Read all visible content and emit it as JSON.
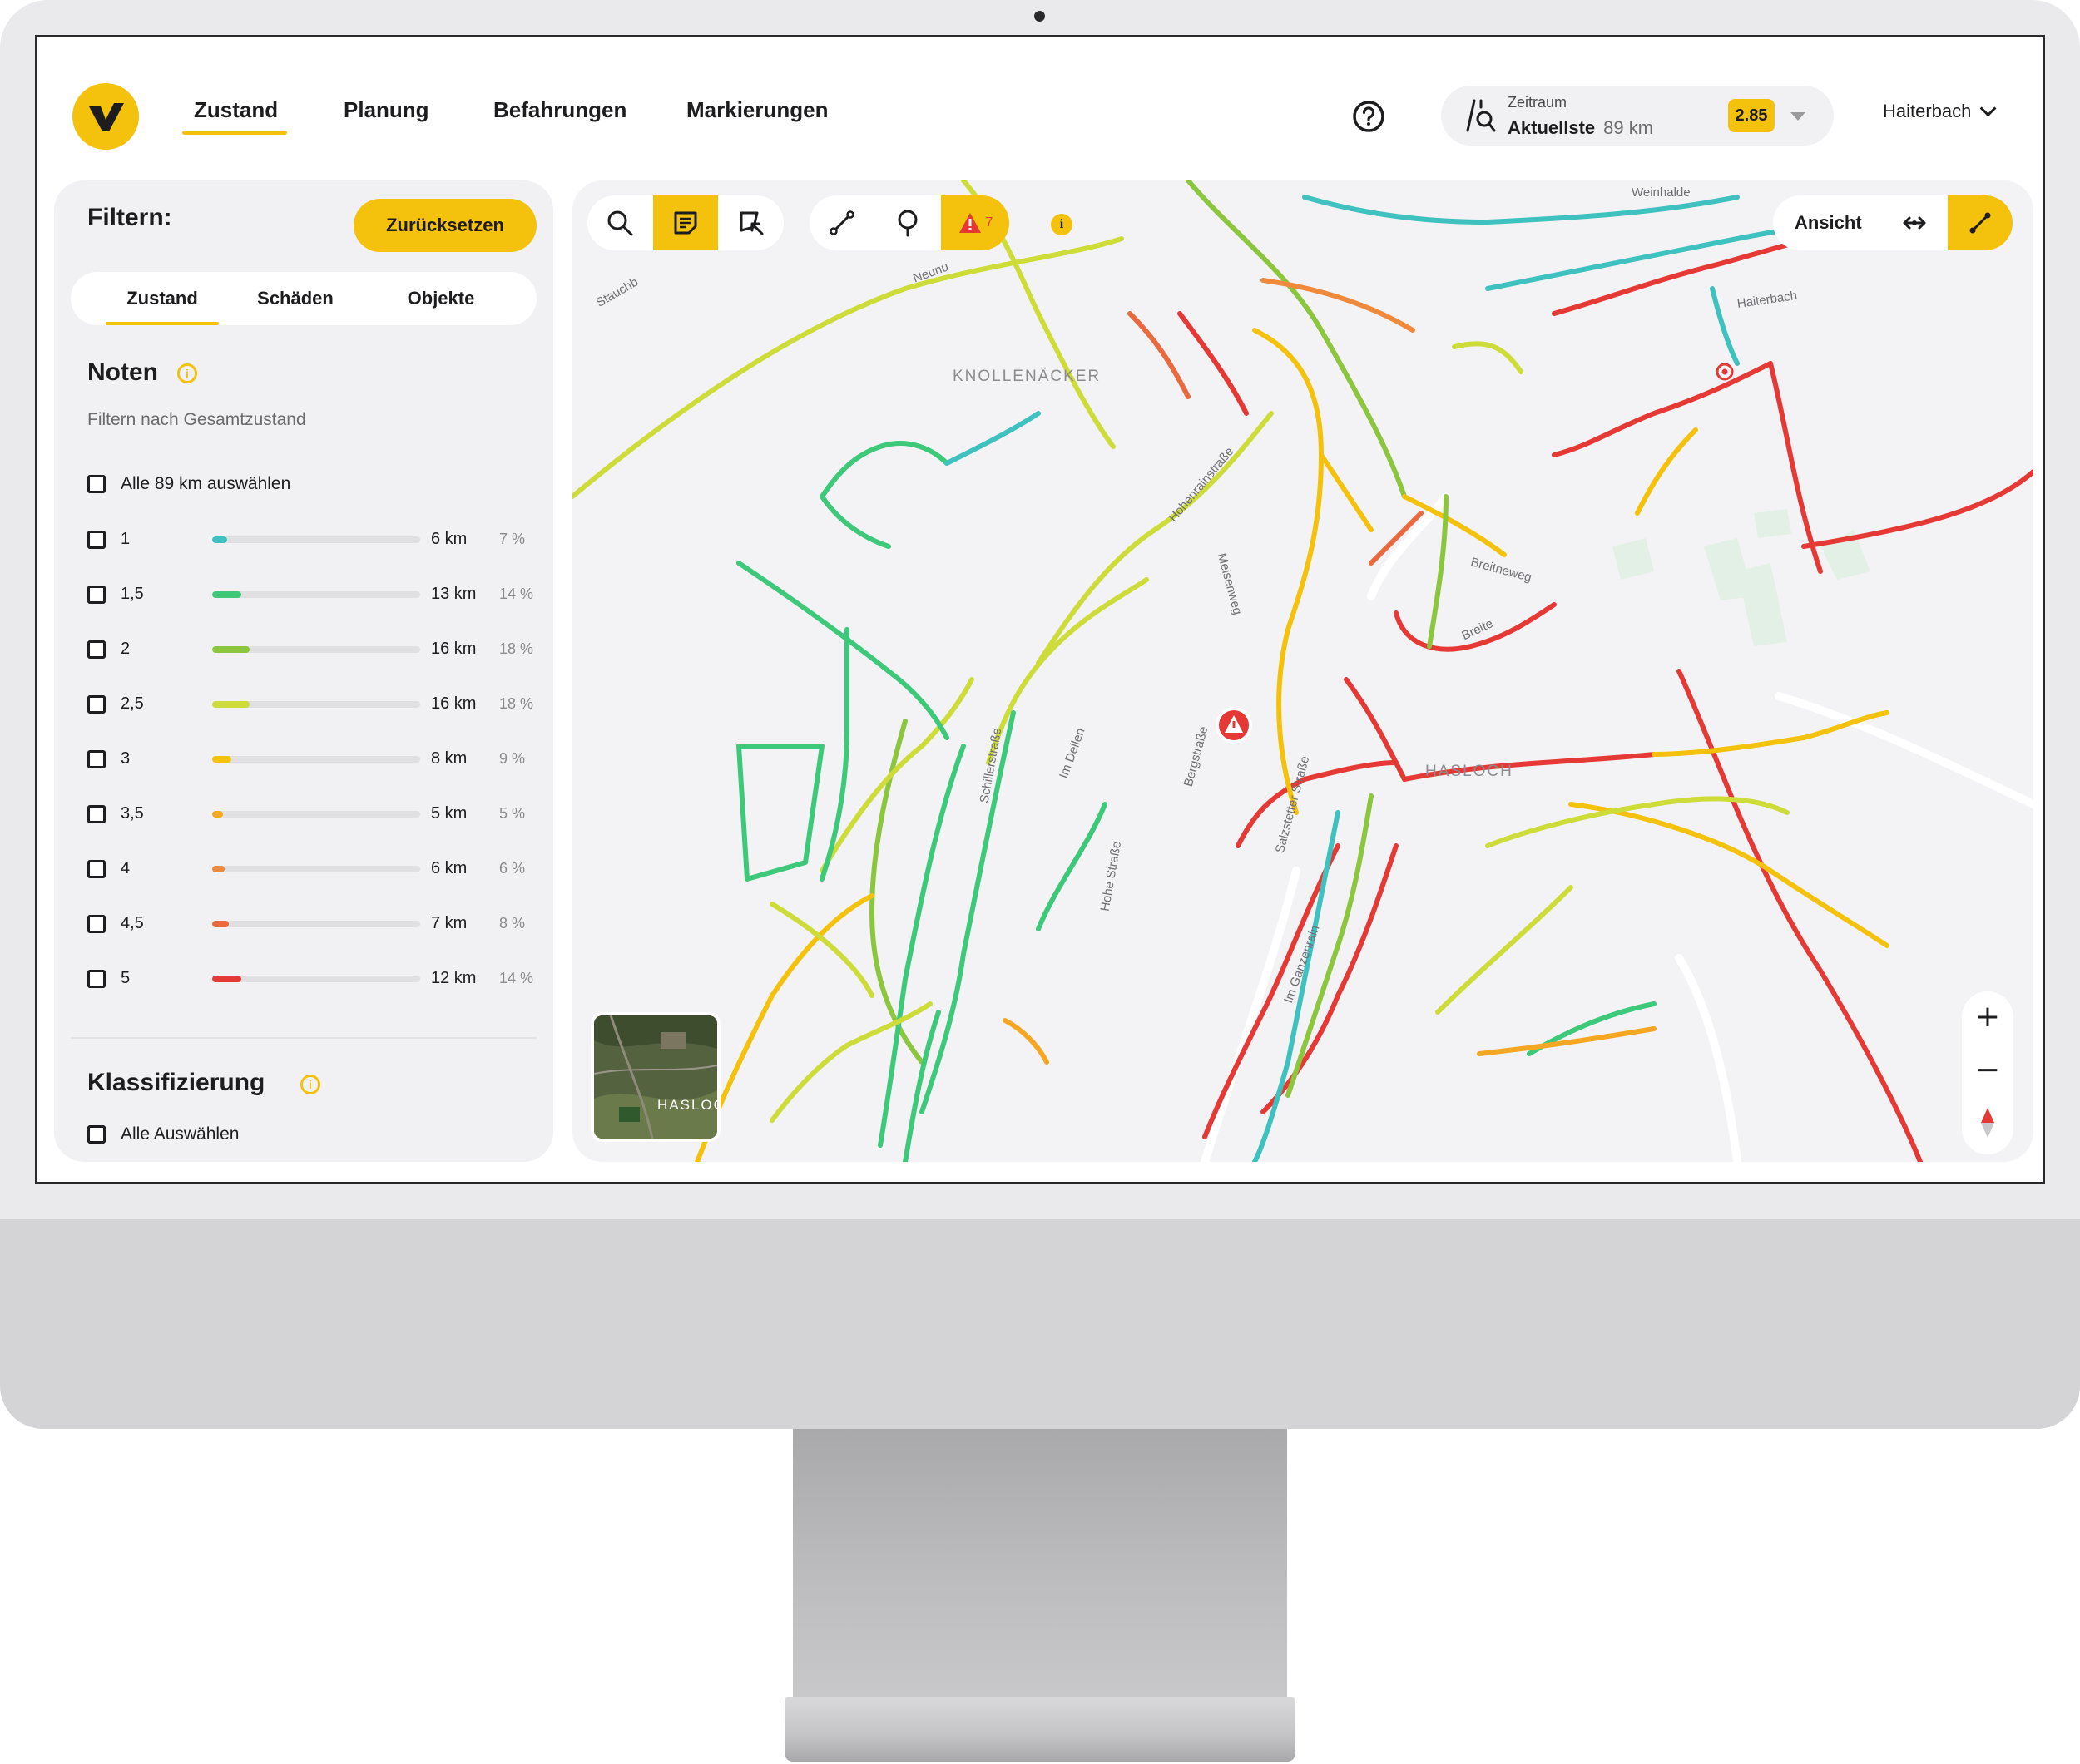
{
  "nav": {
    "tabs": [
      {
        "label": "Zustand",
        "active": true
      },
      {
        "label": "Planung"
      },
      {
        "label": "Befahrungen"
      },
      {
        "label": "Markierungen"
      }
    ]
  },
  "period": {
    "label": "Zeitraum",
    "value": "Aktuellste",
    "km": "89 km",
    "score": "2.85"
  },
  "municipality": "Haiterbach",
  "filter": {
    "title": "Filtern:",
    "reset_label": "Zurücksetzen",
    "tabs": [
      "Zustand",
      "Schäden",
      "Objekte"
    ],
    "grades_title": "Noten",
    "grades_subtitle": "Filtern nach Gesamtzustand",
    "select_all_label": "Alle 89 km auswählen",
    "grades": [
      {
        "grade": "1",
        "km": "6 km",
        "pct": "7 %",
        "fraction": 0.07,
        "color": "#3fc1c0"
      },
      {
        "grade": "1,5",
        "km": "13 km",
        "pct": "14 %",
        "fraction": 0.14,
        "color": "#3ec87a"
      },
      {
        "grade": "2",
        "km": "16 km",
        "pct": "18 %",
        "fraction": 0.18,
        "color": "#8cc63f"
      },
      {
        "grade": "2,5",
        "km": "16 km",
        "pct": "18 %",
        "fraction": 0.18,
        "color": "#cddc39"
      },
      {
        "grade": "3",
        "km": "8 km",
        "pct": "9 %",
        "fraction": 0.09,
        "color": "#f4c10d"
      },
      {
        "grade": "3,5",
        "km": "5 km",
        "pct": "5 %",
        "fraction": 0.05,
        "color": "#f5a623"
      },
      {
        "grade": "4",
        "km": "6 km",
        "pct": "6 %",
        "fraction": 0.06,
        "color": "#ef8a3c"
      },
      {
        "grade": "4,5",
        "km": "7 km",
        "pct": "8 %",
        "fraction": 0.08,
        "color": "#ea6a3f"
      },
      {
        "grade": "5",
        "km": "12 km",
        "pct": "14 %",
        "fraction": 0.14,
        "color": "#e53935"
      }
    ],
    "classification_title": "Klassifizierung",
    "classification_select_all": "Alle Auswählen"
  },
  "map": {
    "place_labels": [
      "KNOLLENÄCKER",
      "HASLOCH"
    ],
    "street_labels": [
      "Weinhalde",
      "Haiterbach",
      "Stauchb",
      "Neunu",
      "Hohenrainstraße",
      "Meisenweg",
      "Breitneweg",
      "Breite",
      "Schillerstraße",
      "Im Dellen",
      "Bergstraße",
      "Salzstetter Straße",
      "Hohe Straße",
      "Im Ganzenrain"
    ],
    "warning_count": "7",
    "view_label": "Ansicht",
    "satellite_label": "HASLOCH",
    "zoom_in": "+",
    "zoom_out": "−"
  },
  "icons": {
    "logo": "v-logo-icon",
    "help": "question-circle-icon",
    "period": "road-search-icon",
    "search": "search-icon",
    "notes": "note-icon",
    "select": "polygon-select-icon",
    "measure": "measure-line-icon",
    "pin": "pin-icon",
    "warning": "warning-triangle-icon",
    "compare": "compare-icon",
    "route": "route-icon",
    "compass": "compass-icon"
  },
  "colors": {
    "accent": "#f4c10d",
    "danger": "#e53935"
  }
}
